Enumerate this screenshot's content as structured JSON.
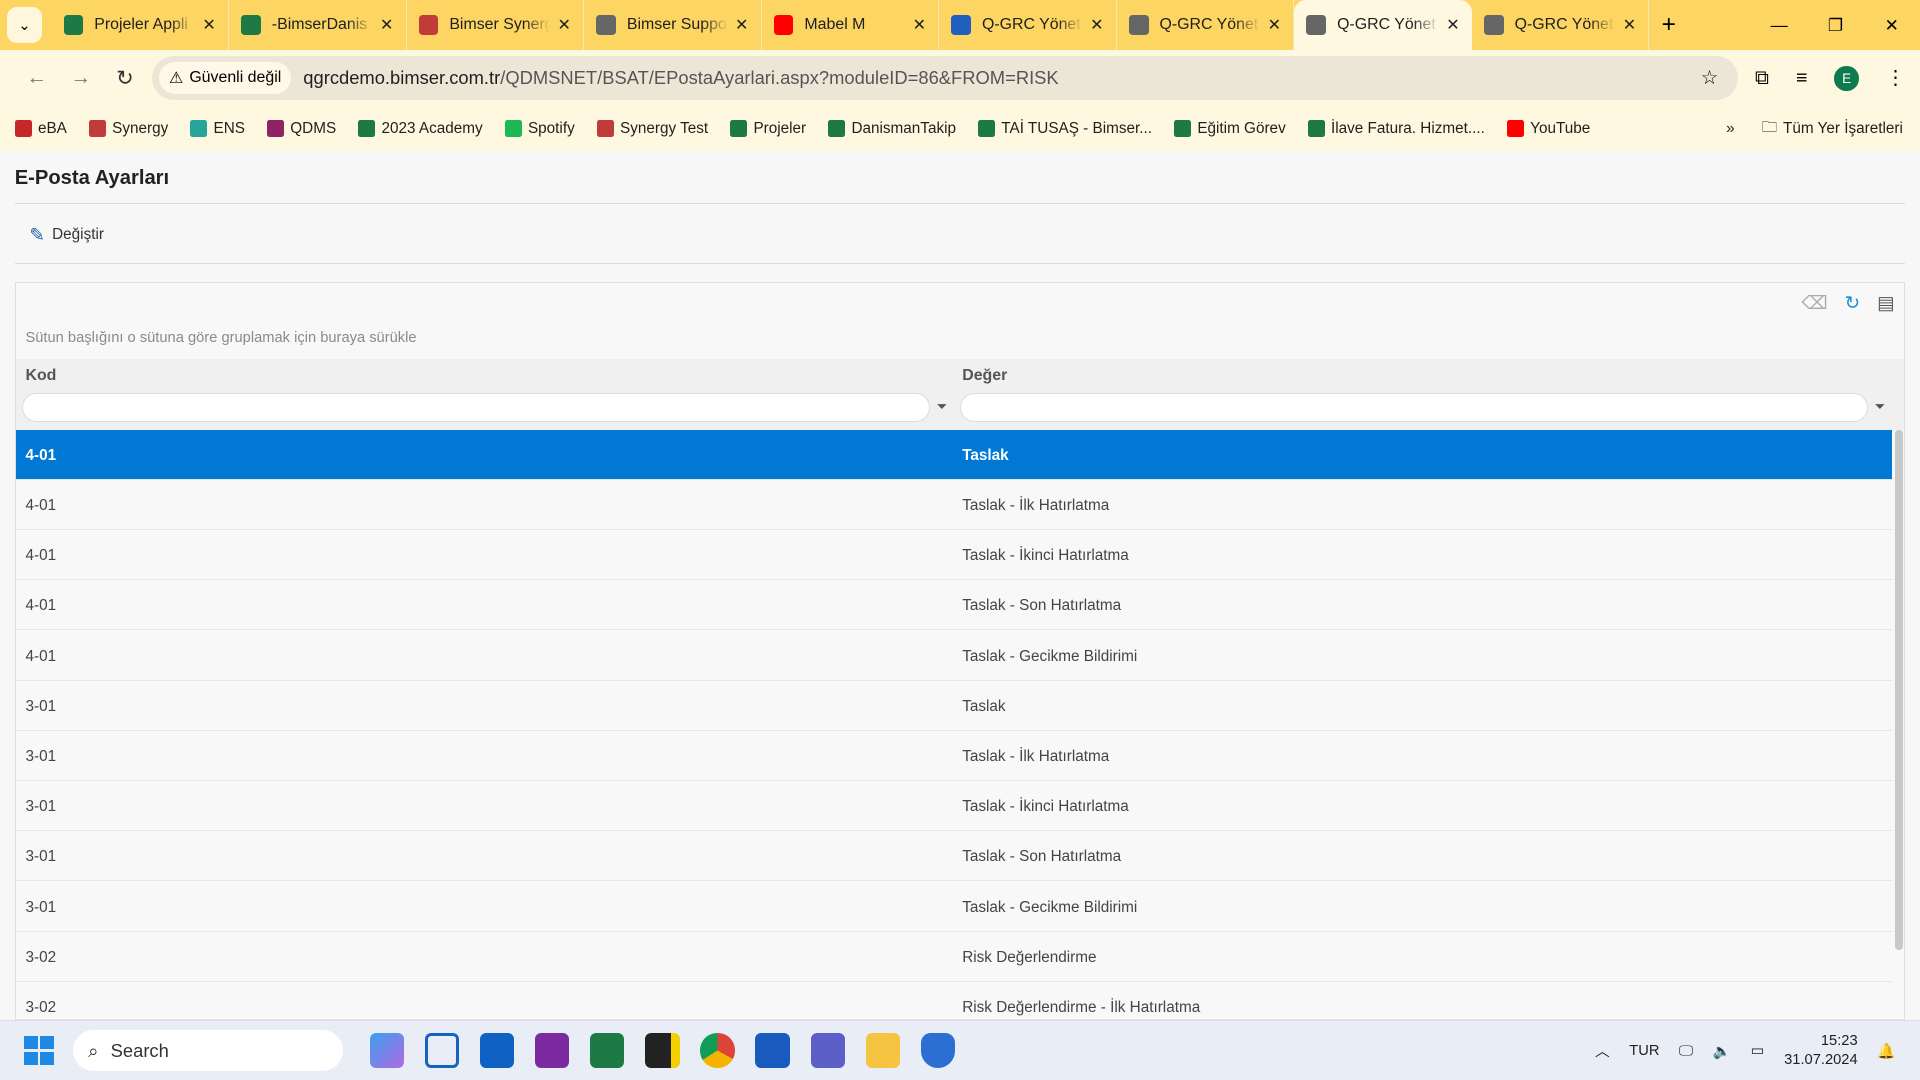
{
  "browser": {
    "tabs": [
      {
        "title": "Projeler Appli",
        "icon": "excel-icon",
        "color": "#1d7a45"
      },
      {
        "title": "-BimserDanis",
        "icon": "excel-icon",
        "color": "#1d7a45"
      },
      {
        "title": "Bimser Synerg",
        "icon": "synergy-icon",
        "color": "#c23b3b"
      },
      {
        "title": "Bimser Suppo",
        "icon": "globe-icon",
        "color": "#666666"
      },
      {
        "title": "Mabel M",
        "icon": "youtube-icon",
        "color": "#ff0000"
      },
      {
        "title": "Q-GRC Yönet",
        "icon": "qgrc-icon",
        "color": "#1f5fbf"
      },
      {
        "title": "Q-GRC Yönet",
        "icon": "globe-icon",
        "color": "#666666"
      },
      {
        "title": "Q-GRC Yönet",
        "icon": "globe-icon",
        "color": "#666666",
        "active": true
      },
      {
        "title": "Q-GRC Yönet",
        "icon": "globe-icon",
        "color": "#666666"
      }
    ],
    "security_chip": "Güvenli değil",
    "url_host": "qgrcdemo.bimser.com.tr",
    "url_path": "/QDMSNET/BSAT/EPostaAyarlari.aspx?moduleID=86&FROM=RISK",
    "profile_initial": "E",
    "bookmarks": [
      {
        "label": "eBA",
        "color": "#c62828"
      },
      {
        "label": "Synergy",
        "color": "#c23b3b"
      },
      {
        "label": "ENS",
        "color": "#26a69a"
      },
      {
        "label": "QDMS",
        "color": "#8e2466"
      },
      {
        "label": "2023 Academy",
        "color": "#1d7a45"
      },
      {
        "label": "Spotify",
        "color": "#1db954"
      },
      {
        "label": "Synergy Test",
        "color": "#c23b3b"
      },
      {
        "label": "Projeler",
        "color": "#1d7a45"
      },
      {
        "label": "DanismanTakip",
        "color": "#1d7a45"
      },
      {
        "label": "TAİ TUSAŞ - Bimser...",
        "color": "#1d7a45"
      },
      {
        "label": "Eğitim Görev",
        "color": "#1d7a45"
      },
      {
        "label": "İlave Fatura. Hizmet....",
        "color": "#1d7a45"
      },
      {
        "label": "YouTube",
        "color": "#ff0000"
      }
    ],
    "all_bookmarks": "Tüm Yer İşaretleri"
  },
  "page": {
    "title": "E-Posta Ayarları",
    "edit_label": "Değiştir",
    "group_hint": "Sütun başlığını o sütuna göre gruplamak için buraya sürükle",
    "columns": [
      "Kod",
      "Değer"
    ],
    "rows": [
      {
        "kod": "4-01",
        "deger": "Taslak",
        "selected": true
      },
      {
        "kod": "4-01",
        "deger": "Taslak - İlk Hatırlatma"
      },
      {
        "kod": "4-01",
        "deger": "Taslak - İkinci Hatırlatma"
      },
      {
        "kod": "4-01",
        "deger": "Taslak - Son Hatırlatma"
      },
      {
        "kod": "4-01",
        "deger": "Taslak - Gecikme Bildirimi"
      },
      {
        "kod": "3-01",
        "deger": "Taslak"
      },
      {
        "kod": "3-01",
        "deger": "Taslak - İlk Hatırlatma"
      },
      {
        "kod": "3-01",
        "deger": "Taslak - İkinci Hatırlatma"
      },
      {
        "kod": "3-01",
        "deger": "Taslak - Son Hatırlatma"
      },
      {
        "kod": "3-01",
        "deger": "Taslak - Gecikme Bildirimi"
      },
      {
        "kod": "3-02",
        "deger": "Risk Değerlendirme"
      },
      {
        "kod": "3-02",
        "deger": "Risk Değerlendirme - İlk Hatırlatma"
      }
    ],
    "selection_color": "#0078d4"
  },
  "taskbar": {
    "search_placeholder": "Search",
    "language": "TUR",
    "time": "15:23",
    "date": "31.07.2024"
  }
}
